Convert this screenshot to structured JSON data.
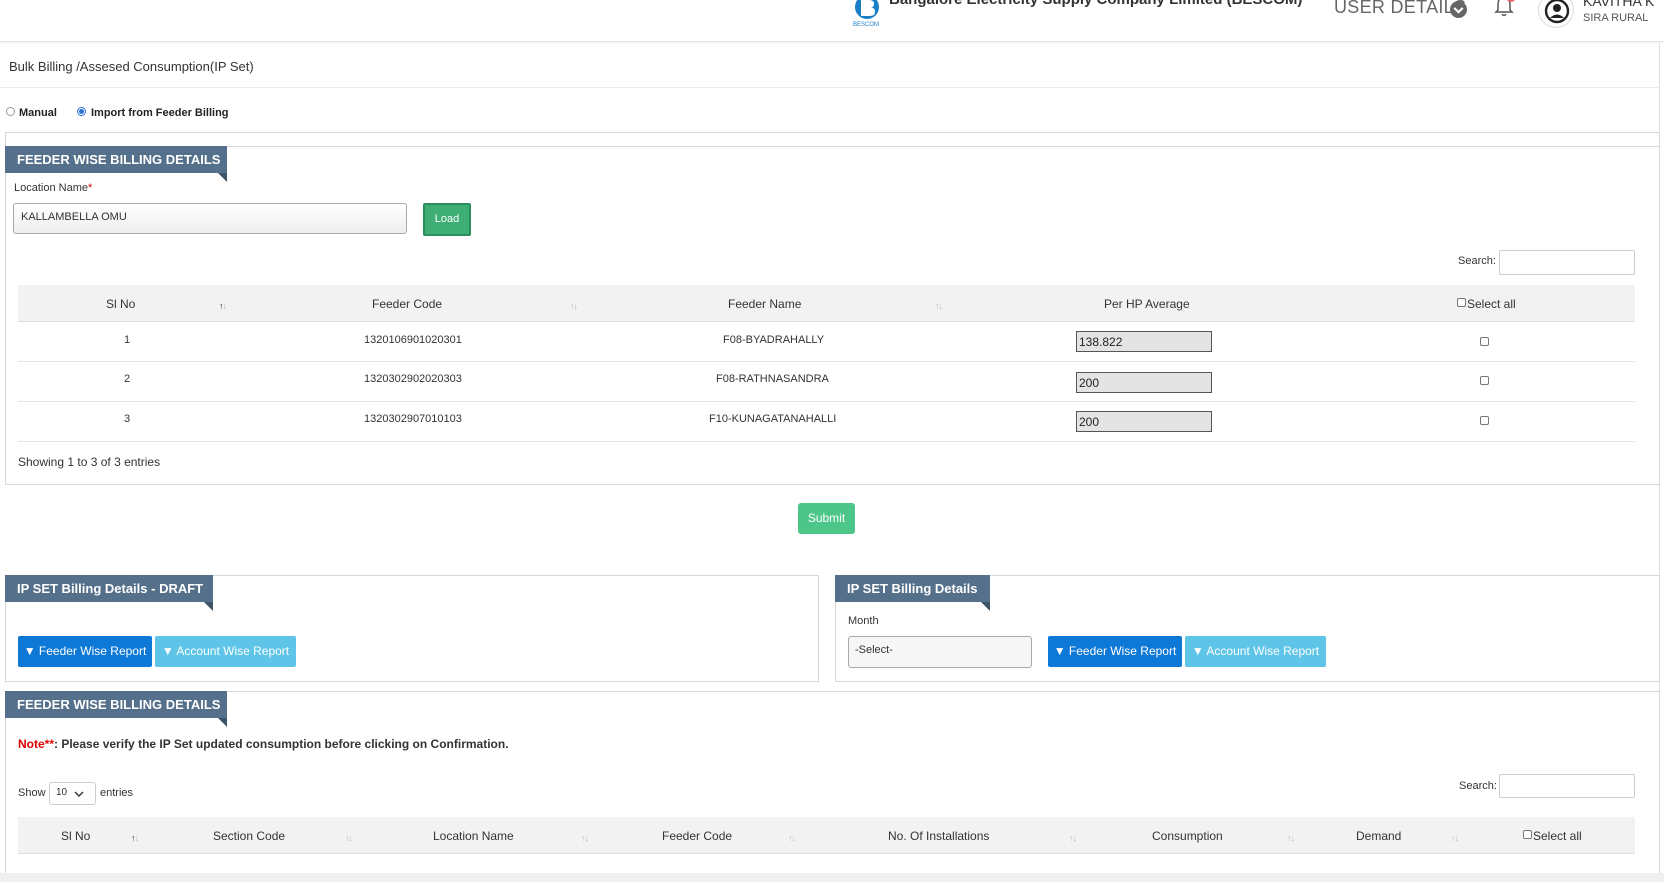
{
  "header": {
    "company": "Bangalore Electricity Supply Company Limited (BESCOM)",
    "logo_text": "BESCOM",
    "user_details_label": "USER DETAILS",
    "user_name": "KAVITHA K",
    "user_location": "SIRA RURAL"
  },
  "breadcrumb": "Bulk Billing /Assesed Consumption(IP Set)",
  "mode": {
    "options": [
      "Manual",
      "Import from Feeder Billing"
    ],
    "selected": "Import from Feeder Billing"
  },
  "feeder_panel": {
    "title": "FEEDER WISE BILLING DETAILS",
    "location_label": "Location Name",
    "required_mark": "*",
    "location_value": "KALLAMBELLA OMU",
    "load_label": "Load",
    "search_label": "Search:",
    "columns": [
      "Sl No",
      "Feeder Code",
      "Feeder Name",
      "Per HP Average",
      "Select all"
    ],
    "rows": [
      {
        "sl": "1",
        "code": "1320106901020301",
        "name": "F08-BYADRAHALLY",
        "avg": "138.822"
      },
      {
        "sl": "2",
        "code": "1320302902020303",
        "name": "F08-RATHNASANDRA",
        "avg": "200"
      },
      {
        "sl": "3",
        "code": "1320302907010103",
        "name": "F10-KUNAGATANAHALLI",
        "avg": "200"
      }
    ],
    "info": "Showing 1 to 3 of 3 entries"
  },
  "submit_label": "Submit",
  "draft_panel": {
    "title": "IP SET Billing Details - DRAFT",
    "feeder_report": "Feeder Wise Report",
    "account_report": "Account Wise Report"
  },
  "ipset_panel": {
    "title": "IP SET Billing Details",
    "month_label": "Month",
    "month_value": "-Select-",
    "feeder_report": "Feeder Wise Report",
    "account_report": "Account Wise Report"
  },
  "feeder_panel2": {
    "title": "FEEDER WISE BILLING DETAILS",
    "note_prefix": "Note**",
    "note_text": ": Please verify the IP Set updated consumption before clicking on Confirmation.",
    "show_label": "Show",
    "show_value": "10",
    "entries_label": "entries",
    "search_label": "Search:",
    "columns": [
      "Sl No",
      "Section Code",
      "Location Name",
      "Feeder Code",
      "No. Of Installations",
      "Consumption",
      "Demand",
      "Select all"
    ]
  },
  "colors": {
    "ribbon": "#55708a",
    "green": "#3fae74",
    "blue": "#0e78d6",
    "light_blue": "#5ec4e8",
    "note_red": "#e00000"
  }
}
